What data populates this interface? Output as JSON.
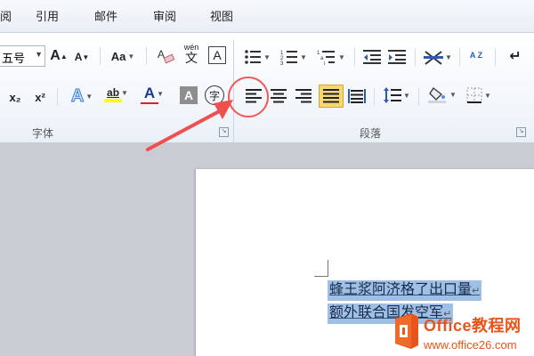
{
  "menu": {
    "items": [
      "阅",
      "引用",
      "邮件",
      "审阅",
      "视图"
    ]
  },
  "font_group": {
    "size_value": "五号",
    "grow_label": "A",
    "shrink_label": "A",
    "case_label": "Aa",
    "subscript_label": "x₂",
    "superscript_label": "x²",
    "effects_label": "A",
    "highlight_label": "ab",
    "font_color_label": "A",
    "shading_label": "A",
    "enclose_label": "字",
    "clear_label": "A",
    "pinyin_label": "wén",
    "label": "字体"
  },
  "paragraph_group": {
    "label": "段落",
    "sort_label": "A Z",
    "align_left_active": false,
    "justify_active": true
  },
  "document": {
    "line1": "蜂王浆阿济格了出口量",
    "line2": "额外联合国发空军",
    "paragraph_mark": "↵"
  },
  "watermark": {
    "brand": "Office教程网",
    "url": "www.office26.com"
  },
  "colors": {
    "annotation": "#ef5b5b",
    "selection": "#9fc0e6",
    "active_button": "#f6d774",
    "highlight": "#ffff00",
    "font_color": "#e02020",
    "watermark": "#e8541a"
  }
}
